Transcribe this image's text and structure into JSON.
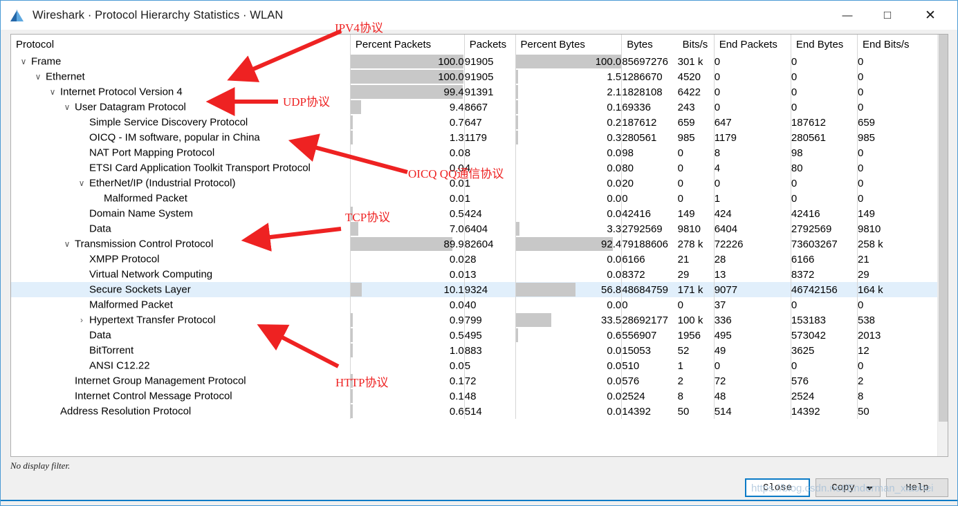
{
  "window": {
    "title": "Wireshark · Protocol Hierarchy Statistics · WLAN",
    "app_icon": "wireshark-fin-icon",
    "minimize_glyph": "—",
    "maximize_glyph": "□",
    "close_glyph": "✕",
    "combo_chevron_glyph": "⌄"
  },
  "table": {
    "columns": [
      "Protocol",
      "Percent Packets",
      "Packets",
      "Percent Bytes",
      "Bytes",
      "Bits/s",
      "End Packets",
      "End Bytes",
      "End Bits/s"
    ],
    "rows": [
      {
        "name": "Frame",
        "depth": 0,
        "twisty": "expanded",
        "percent_packets": "100.0",
        "packets": "91905",
        "percent_bytes": "100.0",
        "bytes": "85697276",
        "bits_s": "301 k",
        "end_packets": "0",
        "end_bytes": "0",
        "end_bits_s": "0",
        "pp_bar": 100,
        "pb_bar": 100,
        "selected": false
      },
      {
        "name": "Ethernet",
        "depth": 1,
        "twisty": "expanded",
        "percent_packets": "100.0",
        "packets": "91905",
        "percent_bytes": "1.5",
        "bytes": "1286670",
        "bits_s": "4520",
        "end_packets": "0",
        "end_bytes": "0",
        "end_bits_s": "0",
        "pp_bar": 100,
        "pb_bar": 1.5,
        "selected": false
      },
      {
        "name": "Internet Protocol Version 4",
        "depth": 2,
        "twisty": "expanded",
        "percent_packets": "99.4",
        "packets": "91391",
        "percent_bytes": "2.1",
        "bytes": "1828108",
        "bits_s": "6422",
        "end_packets": "0",
        "end_bytes": "0",
        "end_bits_s": "0",
        "pp_bar": 99.4,
        "pb_bar": 2.1,
        "selected": false
      },
      {
        "name": "User Datagram Protocol",
        "depth": 3,
        "twisty": "expanded",
        "percent_packets": "9.4",
        "packets": "8667",
        "percent_bytes": "0.1",
        "bytes": "69336",
        "bits_s": "243",
        "end_packets": "0",
        "end_bytes": "0",
        "end_bits_s": "0",
        "pp_bar": 9.4,
        "pb_bar": 0.1,
        "selected": false
      },
      {
        "name": "Simple Service Discovery Protocol",
        "depth": 4,
        "twisty": "none",
        "percent_packets": "0.7",
        "packets": "647",
        "percent_bytes": "0.2",
        "bytes": "187612",
        "bits_s": "659",
        "end_packets": "647",
        "end_bytes": "187612",
        "end_bits_s": "659",
        "pp_bar": 0.7,
        "pb_bar": 0.2,
        "selected": false
      },
      {
        "name": "OICQ - IM software, popular in China",
        "depth": 4,
        "twisty": "none",
        "percent_packets": "1.3",
        "packets": "1179",
        "percent_bytes": "0.3",
        "bytes": "280561",
        "bits_s": "985",
        "end_packets": "1179",
        "end_bytes": "280561",
        "end_bits_s": "985",
        "pp_bar": 1.3,
        "pb_bar": 0.3,
        "selected": false
      },
      {
        "name": "NAT Port Mapping Protocol",
        "depth": 4,
        "twisty": "none",
        "percent_packets": "0.0",
        "packets": "8",
        "percent_bytes": "0.0",
        "bytes": "98",
        "bits_s": "0",
        "end_packets": "8",
        "end_bytes": "98",
        "end_bits_s": "0",
        "pp_bar": 0,
        "pb_bar": 0,
        "selected": false
      },
      {
        "name": "ETSI Card Application Toolkit Transport Protocol",
        "depth": 4,
        "twisty": "none",
        "percent_packets": "0.0",
        "packets": "4",
        "percent_bytes": "0.0",
        "bytes": "80",
        "bits_s": "0",
        "end_packets": "4",
        "end_bytes": "80",
        "end_bits_s": "0",
        "pp_bar": 0,
        "pb_bar": 0,
        "selected": false
      },
      {
        "name": "EtherNet/IP (Industrial Protocol)",
        "depth": 4,
        "twisty": "expanded",
        "percent_packets": "0.0",
        "packets": "1",
        "percent_bytes": "0.0",
        "bytes": "20",
        "bits_s": "0",
        "end_packets": "0",
        "end_bytes": "0",
        "end_bits_s": "0",
        "pp_bar": 0,
        "pb_bar": 0,
        "selected": false
      },
      {
        "name": "Malformed Packet",
        "depth": 5,
        "twisty": "none",
        "percent_packets": "0.0",
        "packets": "1",
        "percent_bytes": "0.0",
        "bytes": "0",
        "bits_s": "0",
        "end_packets": "1",
        "end_bytes": "0",
        "end_bits_s": "0",
        "pp_bar": 0,
        "pb_bar": 0,
        "selected": false
      },
      {
        "name": "Domain Name System",
        "depth": 4,
        "twisty": "none",
        "percent_packets": "0.5",
        "packets": "424",
        "percent_bytes": "0.0",
        "bytes": "42416",
        "bits_s": "149",
        "end_packets": "424",
        "end_bytes": "42416",
        "end_bits_s": "149",
        "pp_bar": 0.5,
        "pb_bar": 0,
        "selected": false
      },
      {
        "name": "Data",
        "depth": 4,
        "twisty": "none",
        "percent_packets": "7.0",
        "packets": "6404",
        "percent_bytes": "3.3",
        "bytes": "2792569",
        "bits_s": "9810",
        "end_packets": "6404",
        "end_bytes": "2792569",
        "end_bits_s": "9810",
        "pp_bar": 7.0,
        "pb_bar": 3.3,
        "selected": false
      },
      {
        "name": "Transmission Control Protocol",
        "depth": 3,
        "twisty": "expanded",
        "percent_packets": "89.9",
        "packets": "82604",
        "percent_bytes": "92.4",
        "bytes": "79188606",
        "bits_s": "278 k",
        "end_packets": "72226",
        "end_bytes": "73603267",
        "end_bits_s": "258 k",
        "pp_bar": 89.9,
        "pb_bar": 92.4,
        "selected": false
      },
      {
        "name": "XMPP Protocol",
        "depth": 4,
        "twisty": "none",
        "percent_packets": "0.0",
        "packets": "28",
        "percent_bytes": "0.0",
        "bytes": "6166",
        "bits_s": "21",
        "end_packets": "28",
        "end_bytes": "6166",
        "end_bits_s": "21",
        "pp_bar": 0,
        "pb_bar": 0,
        "selected": false
      },
      {
        "name": "Virtual Network Computing",
        "depth": 4,
        "twisty": "none",
        "percent_packets": "0.0",
        "packets": "13",
        "percent_bytes": "0.0",
        "bytes": "8372",
        "bits_s": "29",
        "end_packets": "13",
        "end_bytes": "8372",
        "end_bits_s": "29",
        "pp_bar": 0,
        "pb_bar": 0,
        "selected": false
      },
      {
        "name": "Secure Sockets Layer",
        "depth": 4,
        "twisty": "none",
        "percent_packets": "10.1",
        "packets": "9324",
        "percent_bytes": "56.8",
        "bytes": "48684759",
        "bits_s": "171 k",
        "end_packets": "9077",
        "end_bytes": "46742156",
        "end_bits_s": "164 k",
        "pp_bar": 10.1,
        "pb_bar": 56.8,
        "selected": true
      },
      {
        "name": "Malformed Packet",
        "depth": 4,
        "twisty": "none",
        "percent_packets": "0.0",
        "packets": "40",
        "percent_bytes": "0.0",
        "bytes": "0",
        "bits_s": "0",
        "end_packets": "37",
        "end_bytes": "0",
        "end_bits_s": "0",
        "pp_bar": 0,
        "pb_bar": 0,
        "selected": false
      },
      {
        "name": "Hypertext Transfer Protocol",
        "depth": 4,
        "twisty": "collapsed",
        "percent_packets": "0.9",
        "packets": "799",
        "percent_bytes": "33.5",
        "bytes": "28692177",
        "bits_s": "100 k",
        "end_packets": "336",
        "end_bytes": "153183",
        "end_bits_s": "538",
        "pp_bar": 0.9,
        "pb_bar": 33.5,
        "selected": false
      },
      {
        "name": "Data",
        "depth": 4,
        "twisty": "none",
        "percent_packets": "0.5",
        "packets": "495",
        "percent_bytes": "0.6",
        "bytes": "556907",
        "bits_s": "1956",
        "end_packets": "495",
        "end_bytes": "573042",
        "end_bits_s": "2013",
        "pp_bar": 0.5,
        "pb_bar": 0.6,
        "selected": false
      },
      {
        "name": "BitTorrent",
        "depth": 4,
        "twisty": "none",
        "percent_packets": "1.0",
        "packets": "883",
        "percent_bytes": "0.0",
        "bytes": "15053",
        "bits_s": "52",
        "end_packets": "49",
        "end_bytes": "3625",
        "end_bits_s": "12",
        "pp_bar": 1.0,
        "pb_bar": 0,
        "selected": false
      },
      {
        "name": "ANSI C12.22",
        "depth": 4,
        "twisty": "none",
        "percent_packets": "0.0",
        "packets": "5",
        "percent_bytes": "0.0",
        "bytes": "510",
        "bits_s": "1",
        "end_packets": "0",
        "end_bytes": "0",
        "end_bits_s": "0",
        "pp_bar": 0,
        "pb_bar": 0,
        "selected": false
      },
      {
        "name": "Internet Group Management Protocol",
        "depth": 3,
        "twisty": "none",
        "percent_packets": "0.1",
        "packets": "72",
        "percent_bytes": "0.0",
        "bytes": "576",
        "bits_s": "2",
        "end_packets": "72",
        "end_bytes": "576",
        "end_bits_s": "2",
        "pp_bar": 0.1,
        "pb_bar": 0,
        "selected": false
      },
      {
        "name": "Internet Control Message Protocol",
        "depth": 3,
        "twisty": "none",
        "percent_packets": "0.1",
        "packets": "48",
        "percent_bytes": "0.0",
        "bytes": "2524",
        "bits_s": "8",
        "end_packets": "48",
        "end_bytes": "2524",
        "end_bits_s": "8",
        "pp_bar": 0.1,
        "pb_bar": 0,
        "selected": false
      },
      {
        "name": "Address Resolution Protocol",
        "depth": 2,
        "twisty": "none",
        "percent_packets": "0.6",
        "packets": "514",
        "percent_bytes": "0.0",
        "bytes": "14392",
        "bits_s": "50",
        "end_packets": "514",
        "end_bytes": "14392",
        "end_bits_s": "50",
        "pp_bar": 0.6,
        "pb_bar": 0,
        "selected": false
      }
    ]
  },
  "status": {
    "text": "No display filter."
  },
  "footer": {
    "close_label": "Close",
    "copy_label": "Copy",
    "help_label": "Help"
  },
  "watermark": {
    "text": "https://blog.csdn.net/Enderman_xiaohei"
  },
  "annotations": [
    {
      "id": "ipv4",
      "text": "IPV4协议"
    },
    {
      "id": "udp",
      "text": "UDP协议"
    },
    {
      "id": "oicq",
      "text": "OICQ QQ通信协议"
    },
    {
      "id": "tcp",
      "text": "TCP协议"
    },
    {
      "id": "http",
      "text": "HTTP协议"
    }
  ],
  "colors": {
    "accent": "#0a7ac6",
    "bar": "#c8c8c8",
    "selection": "#e1effb",
    "annotation": "#ee2222"
  }
}
